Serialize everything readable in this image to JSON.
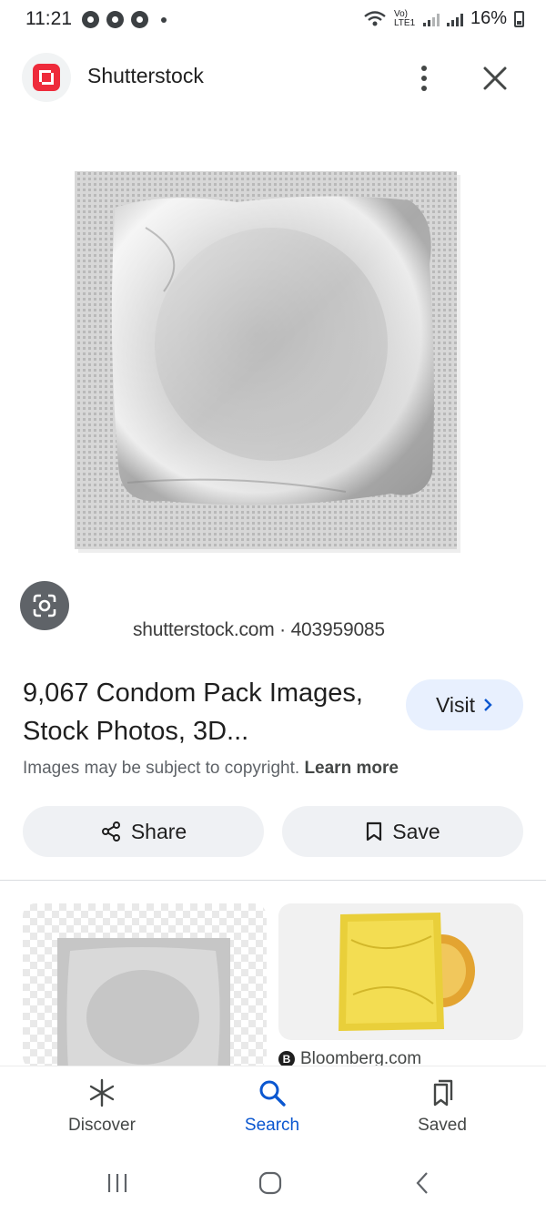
{
  "status_bar": {
    "time": "11:21",
    "network": "Vo) LTE1",
    "battery": "16%"
  },
  "header": {
    "site_name": "Shutterstock",
    "favicon": "shutterstock-logo",
    "more_icon": "more-vert-icon",
    "close_icon": "close-icon"
  },
  "main_image": {
    "subject": "silver foil square condom packet",
    "watermark": "shutterstock.com · 403959085"
  },
  "result": {
    "title": "9,067 Condom Pack Images, Stock Photos, 3D...",
    "visit_label": "Visit",
    "copyright_text": "Images may be subject to copyright.",
    "learn_more": "Learn more"
  },
  "actions": {
    "share_label": "Share",
    "save_label": "Save"
  },
  "related": [
    {
      "subject": "silver foil condom packet on transparent background",
      "source": ""
    },
    {
      "subject": "yellow condom packet with condom",
      "source": "Bloomberg.com"
    }
  ],
  "bottom_nav": [
    {
      "label": "Discover",
      "icon": "asterisk-icon",
      "active": false
    },
    {
      "label": "Search",
      "icon": "search-icon",
      "active": true
    },
    {
      "label": "Saved",
      "icon": "bookmarks-icon",
      "active": false
    }
  ],
  "colors": {
    "accent": "#0b57d0",
    "visit_bg": "#e8f0fe",
    "pill_bg": "#eff1f4",
    "brand": "#ee2b3b"
  }
}
